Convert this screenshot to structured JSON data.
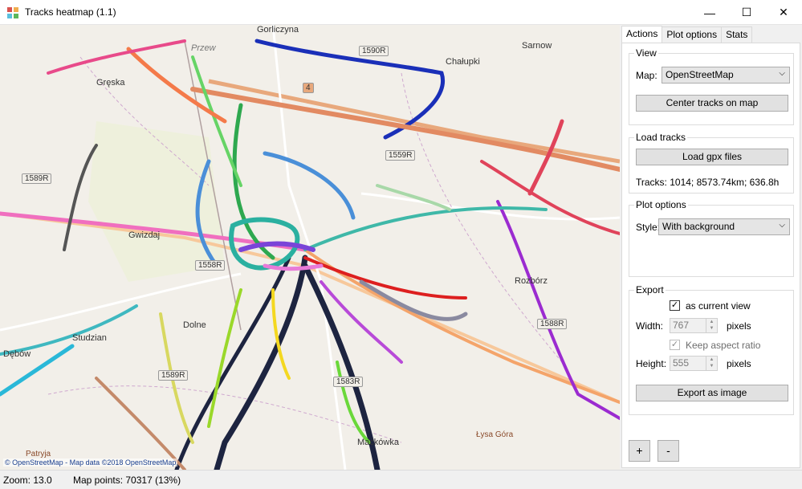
{
  "window": {
    "title": "Tracks heatmap (1.1)",
    "minimize_glyph": "—",
    "maximize_glyph": "☐",
    "close_glyph": "✕"
  },
  "map": {
    "place_labels": [
      "Gorliczyna",
      "Przew",
      "Chałupki",
      "Sarnow",
      "Gręska",
      "Gwizdaj",
      "Studzian",
      "Dolne",
      "Rozbórz",
      "Patryja",
      "Maćkówka",
      "Łysa Góra",
      "Dębów"
    ],
    "road_labels": [
      "1590R",
      "1589R",
      "4",
      "1559R",
      "1558R",
      "1589R",
      "1583R",
      "1588R"
    ],
    "attribution": "© OpenStreetMap - Map data ©2018 OpenStreetMap"
  },
  "tabs": [
    "Actions",
    "Plot options",
    "Stats"
  ],
  "view_group": {
    "title": "View",
    "map_label": "Map:",
    "map_value": "OpenStreetMap",
    "center_button": "Center tracks on map"
  },
  "load_group": {
    "title": "Load tracks",
    "load_button": "Load gpx files",
    "tracks_info": "Tracks: 1014;  8573.74km;  636.8h"
  },
  "plot_group": {
    "title": "Plot options",
    "style_label": "Style:",
    "style_value": "With background"
  },
  "export_group": {
    "title": "Export",
    "as_current_view_label": "as current view",
    "as_current_view_checked": true,
    "width_label": "Width:",
    "width_value": "767",
    "width_unit": "pixels",
    "keep_aspect_label": "Keep aspect ratio",
    "keep_aspect_checked": true,
    "height_label": "Height:",
    "height_value": "555",
    "height_unit": "pixels",
    "export_button": "Export as image"
  },
  "zoom_controls": {
    "plus": "+",
    "minus": "-"
  },
  "status": {
    "zoom": "Zoom: 13.0",
    "map_points": "Map points: 70317 (13%)"
  },
  "colors": {
    "map_background": "#f2efe9",
    "major_road": "#e8a87c",
    "panel_background": "#f0f0f0"
  }
}
